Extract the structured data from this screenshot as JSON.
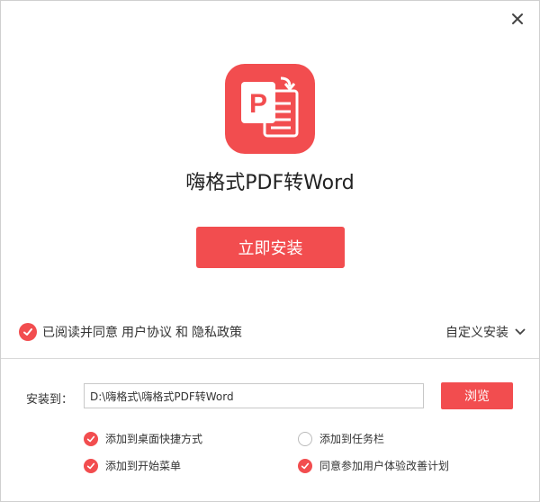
{
  "app": {
    "name": "嗨格式PDF转Word",
    "logo_letter": "P"
  },
  "colors": {
    "accent": "#f24d4f",
    "text": "#333333"
  },
  "install_button_label": "立即安装",
  "agreement": {
    "prefix": "已阅读并同意",
    "user_agreement": "用户协议",
    "and": "和",
    "privacy_policy": "隐私政策",
    "checked": true
  },
  "custom_install_label": "自定义安装",
  "install_path": {
    "label": "安装到：",
    "value": "D:\\嗨格式\\嗨格式PDF转Word",
    "browse_label": "浏览"
  },
  "options": [
    {
      "label": "添加到桌面快捷方式",
      "checked": true
    },
    {
      "label": "添加到任务栏",
      "checked": false
    },
    {
      "label": "添加到开始菜单",
      "checked": true
    },
    {
      "label": "同意参加用户体验改善计划",
      "checked": true
    }
  ],
  "icons": {
    "close": "close-icon",
    "expand": "chevron-down-icon",
    "check": "check-icon"
  }
}
